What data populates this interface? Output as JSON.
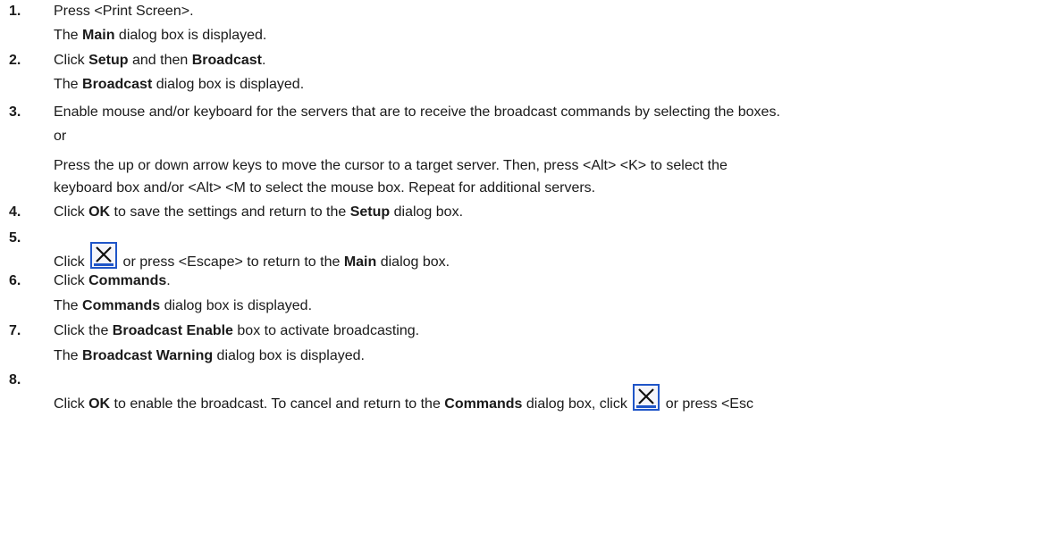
{
  "steps": [
    {
      "num": "1.",
      "lines": [
        {
          "segs": [
            {
              "t": "Press <Print Screen>."
            }
          ]
        },
        {
          "segs": [
            {
              "t": "The "
            },
            {
              "t": "Main",
              "b": true
            },
            {
              "t": " dialog box is displayed."
            }
          ]
        }
      ]
    },
    {
      "num": "2.",
      "lines": [
        {
          "segs": [
            {
              "t": "Click "
            },
            {
              "t": "Setup",
              "b": true
            },
            {
              "t": " and then "
            },
            {
              "t": "Broadcast",
              "b": true
            },
            {
              "t": "."
            }
          ]
        },
        {
          "segs": [
            {
              "t": "The "
            },
            {
              "t": "Broadcast",
              "b": true
            },
            {
              "t": " dialog box is displayed."
            }
          ]
        }
      ]
    },
    {
      "num": "3.",
      "lines": [
        {
          "segs": [
            {
              "t": "Enable mouse and/or keyboard for the servers that are to receive the broadcast commands by selecting the boxes."
            }
          ]
        },
        {
          "segs": [
            {
              "t": "or"
            }
          ]
        },
        {
          "segs": [
            {
              "t": "Press the up or down arrow keys to move the cursor to a target server. Then, press <Alt> <K> to select the"
            }
          ]
        },
        {
          "segs": [
            {
              "t": "keyboard box and/or <Alt> <M to select the mouse box. Repeat for additional servers."
            }
          ]
        }
      ]
    },
    {
      "num": "4.",
      "lines": [
        {
          "segs": [
            {
              "t": "Click "
            },
            {
              "t": "OK",
              "b": true
            },
            {
              "t": " to save the settings and return to the "
            },
            {
              "t": "Setup",
              "b": true
            },
            {
              "t": " dialog box."
            }
          ]
        }
      ]
    },
    {
      "num": "5.",
      "lines": [
        {
          "segs": [
            {
              "t": "Click "
            },
            {
              "icon": "close-x-icon"
            },
            {
              "t": " or press <Escape> to return to the "
            },
            {
              "t": "Main",
              "b": true
            },
            {
              "t": " dialog box."
            }
          ]
        }
      ]
    },
    {
      "num": "6.",
      "lines": [
        {
          "segs": [
            {
              "t": "Click "
            },
            {
              "t": "Commands",
              "b": true
            },
            {
              "t": "."
            }
          ]
        },
        {
          "segs": [
            {
              "t": "The "
            },
            {
              "t": "Commands",
              "b": true
            },
            {
              "t": " dialog box is displayed."
            }
          ]
        }
      ]
    },
    {
      "num": "7.",
      "lines": [
        {
          "segs": [
            {
              "t": "Click the "
            },
            {
              "t": "Broadcast Enable",
              "b": true
            },
            {
              "t": " box to activate broadcasting."
            }
          ]
        },
        {
          "segs": [
            {
              "t": "The "
            },
            {
              "t": "Broadcast Warning",
              "b": true
            },
            {
              "t": " dialog box is displayed."
            }
          ]
        }
      ]
    },
    {
      "num": "8.",
      "lines": [
        {
          "segs": [
            {
              "t": "Click "
            },
            {
              "t": "OK",
              "b": true
            },
            {
              "t": " to enable the broadcast. To cancel and return to the "
            },
            {
              "t": "Commands",
              "b": true
            },
            {
              "t": " dialog box, click "
            },
            {
              "icon": "close-x-icon"
            },
            {
              "t": " or press <Esc"
            }
          ]
        }
      ]
    }
  ],
  "icon_colors": {
    "border": "#1f55c8",
    "fill": "#f5f5fa",
    "x": "#111111"
  }
}
